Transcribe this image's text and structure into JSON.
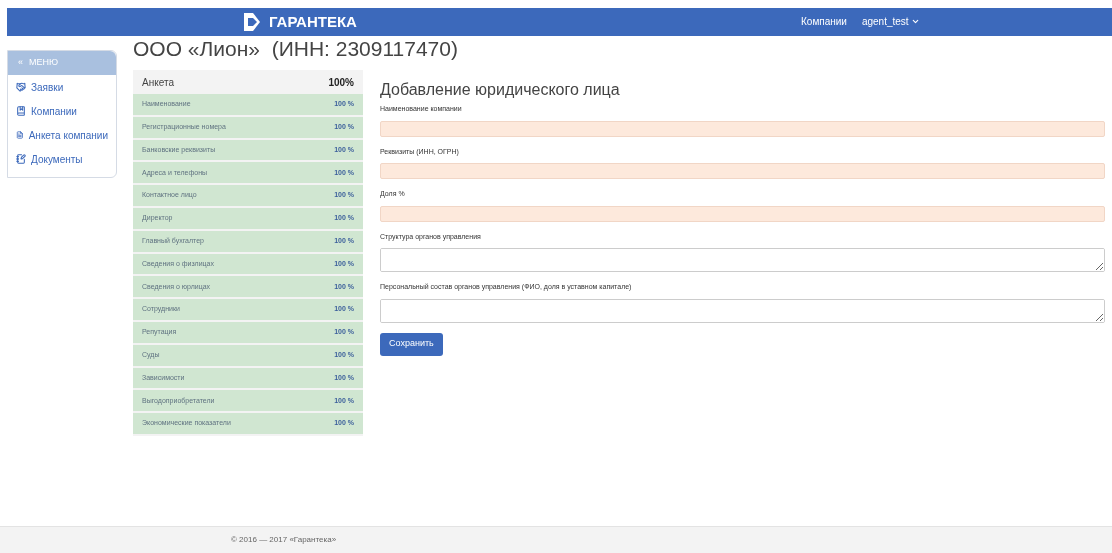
{
  "navbar": {
    "brand": "ГАРАНТЕКА",
    "links": [
      "Компании"
    ],
    "user": "agent_test"
  },
  "page_title": "ООО «Лион»  (ИНН: 2309117470)",
  "sidebar": {
    "header": "МЕНЮ",
    "header_icon": "«",
    "items": [
      {
        "label": "Заявки"
      },
      {
        "label": "Компании"
      },
      {
        "label": "Анкета компании"
      },
      {
        "label": "Документы"
      }
    ]
  },
  "questionnaire": {
    "title": "Анкета",
    "total": "100%",
    "rows": [
      {
        "label": "Наименование",
        "value": "100 %"
      },
      {
        "label": "Регистрационные номера",
        "value": "100 %"
      },
      {
        "label": "Банковские реквизиты",
        "value": "100 %"
      },
      {
        "label": "Адреса и телефоны",
        "value": "100 %"
      },
      {
        "label": "Контактное лицо",
        "value": "100 %"
      },
      {
        "label": "Директор",
        "value": "100 %"
      },
      {
        "label": "Главный бухгалтер",
        "value": "100 %"
      },
      {
        "label": "Сведения о физлицах",
        "value": "100 %"
      },
      {
        "label": "Сведения о юрлицах",
        "value": "100 %"
      },
      {
        "label": "Сотрудники",
        "value": "100 %"
      },
      {
        "label": "Репутация",
        "value": "100 %"
      },
      {
        "label": "Суды",
        "value": "100 %"
      },
      {
        "label": "Зависимости",
        "value": "100 %"
      },
      {
        "label": "Выгодоприобретатели",
        "value": "100 %"
      },
      {
        "label": "Экономические показатели",
        "value": "100 %"
      }
    ]
  },
  "form": {
    "title": "Добавление юридического лица",
    "fields": [
      {
        "label": "Наименование компании",
        "kind": "input",
        "highlighted": true
      },
      {
        "label": "Реквизиты (ИНН, ОГРН)",
        "kind": "input",
        "highlighted": true
      },
      {
        "label": "Доля %",
        "kind": "input",
        "highlighted": true
      },
      {
        "label": "Структура органов управления",
        "kind": "textarea",
        "highlighted": false
      },
      {
        "label": "Персональный состав органов управления (ФИО, доля в уставном капитале)",
        "kind": "textarea",
        "highlighted": false
      }
    ],
    "submit": "Сохранить"
  },
  "footer": "© 2016 — 2017 «Гарантека»"
}
